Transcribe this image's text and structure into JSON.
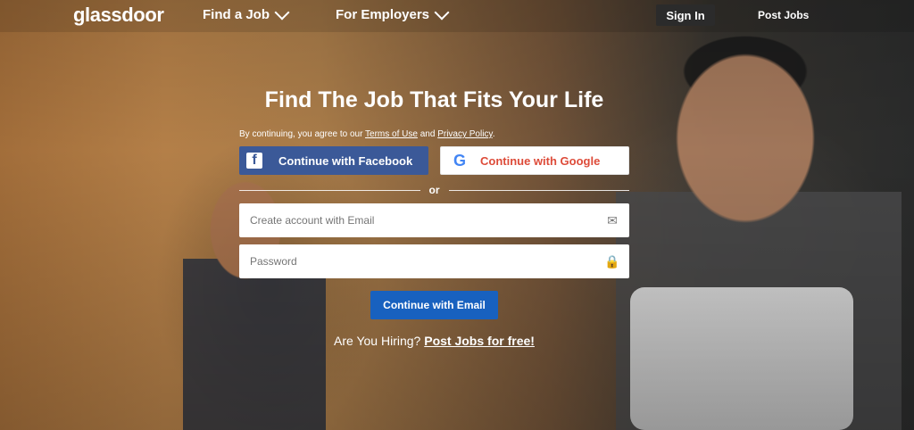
{
  "nav": {
    "logo": "glassdoor",
    "find_job": "Find a Job",
    "for_employers": "For Employers",
    "sign_in": "Sign In",
    "post_jobs": "Post Jobs"
  },
  "hero": {
    "title": "Find The Job That Fits Your Life",
    "terms_prefix": "By continuing, you agree to our ",
    "terms_of_use": "Terms of Use",
    "terms_and": " and ",
    "privacy_policy": "Privacy Policy",
    "terms_suffix": ".",
    "facebook_label": "Continue with Facebook",
    "google_label": "Continue with Google",
    "or_text": "or",
    "email_placeholder": "Create account with Email",
    "password_placeholder": "Password",
    "continue_email": "Continue with Email",
    "hiring_text": "Are You Hiring? ",
    "post_free": "Post Jobs for free!"
  },
  "icons": {
    "facebook": "facebook-icon",
    "google": "google-icon",
    "mail": "mail-icon",
    "lock": "lock-icon",
    "chevron": "chevron-down-icon"
  },
  "colors": {
    "facebook": "#3b5998",
    "google_text": "#dd4b39",
    "primary_button": "#1861bf",
    "sign_in_bg": "#2b2b2b"
  }
}
